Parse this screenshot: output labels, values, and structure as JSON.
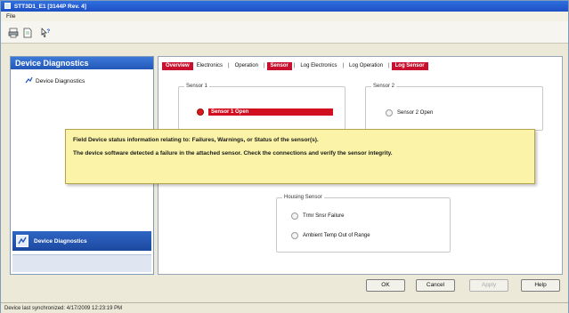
{
  "window": {
    "title": "STT3D1_E1 [3144P Rev. 4]"
  },
  "menu": {
    "file": "File"
  },
  "left_pane": {
    "header": "Device Diagnostics",
    "tree_item": "Device Diagnostics",
    "nav_button": "Device Diagnostics"
  },
  "tabs": [
    {
      "label": "Overview",
      "style": "red"
    },
    {
      "label": "Electronics",
      "style": "plain"
    },
    {
      "label": "Operation",
      "style": "plain"
    },
    {
      "label": "Sensor",
      "style": "active"
    },
    {
      "label": "Log Electronics",
      "style": "plain"
    },
    {
      "label": "Log Operation",
      "style": "plain"
    },
    {
      "label": "Log Sensor",
      "style": "red"
    }
  ],
  "groups": {
    "sensor1": {
      "label": "Sensor 1",
      "item": "Sensor 1 Open",
      "state": "alarm"
    },
    "sensor2": {
      "label": "Sensor 2",
      "item": "Sensor 2 Open",
      "state": "normal"
    },
    "housing": {
      "label": "Housing Sensor",
      "items": [
        "Trmr Snsr Failure",
        "Ambient Temp Out of Range"
      ]
    }
  },
  "tooltip": {
    "line1": "Field Device status information relating to: Failures, Warnings, or Status of the sensor(s).",
    "line2": "The device software detected a failure in the attached sensor. Check the connections and verify the sensor integrity."
  },
  "buttons": {
    "ok": "OK",
    "cancel": "Cancel",
    "apply": "Apply",
    "help": "Help"
  },
  "status": {
    "text": "Device last synchronized: 4/17/2009 12:23:19 PM"
  },
  "colors": {
    "alarm": "#d20f1f",
    "title_blue": "#1d4fc4",
    "tooltip_bg": "#fbf4a8"
  }
}
